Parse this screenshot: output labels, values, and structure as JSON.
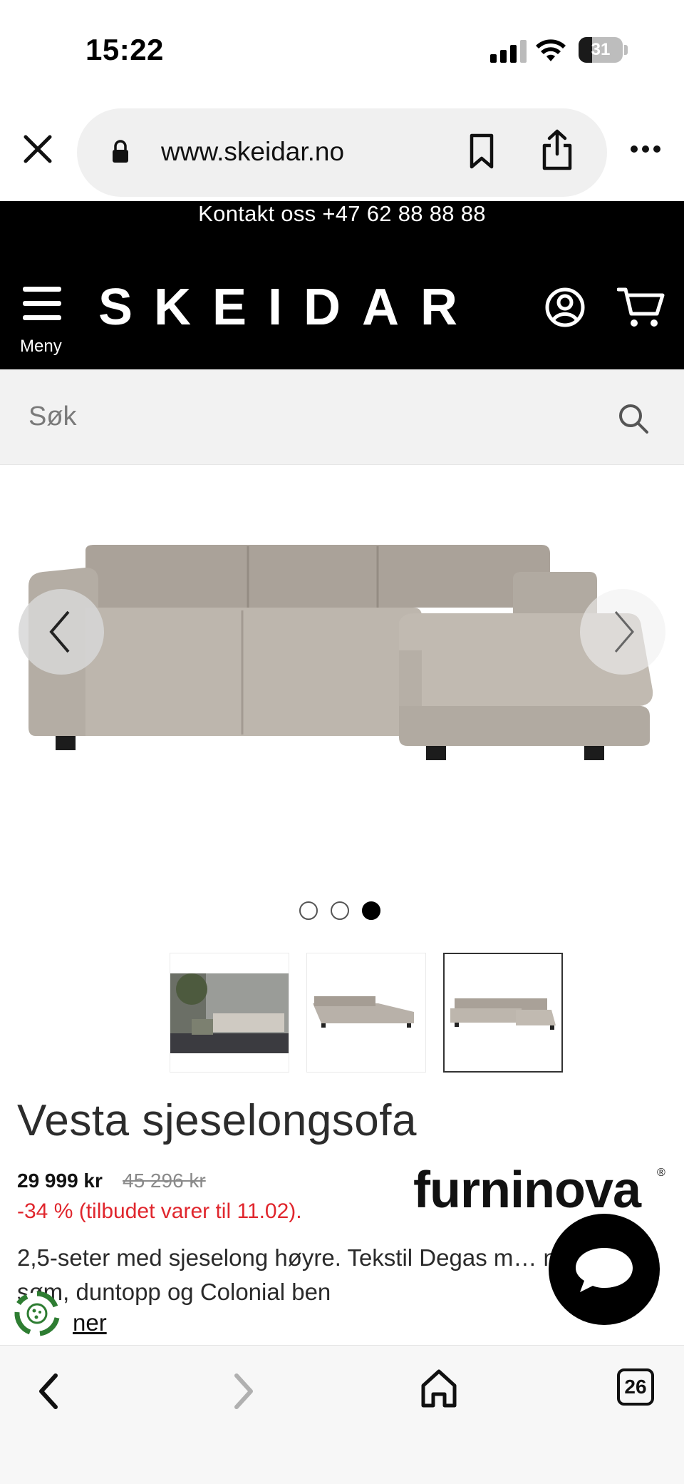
{
  "status_bar": {
    "time": "15:22",
    "battery_level": "31",
    "battery_fraction": 0.31
  },
  "browser": {
    "url": "www.skeidar.no",
    "tab_count": "26"
  },
  "header": {
    "contact": "Kontakt oss +47 62 88 88 88",
    "menu_label": "Meny",
    "logo": "SKEIDAR"
  },
  "search": {
    "placeholder": "Søk"
  },
  "gallery": {
    "slide_count": 3,
    "active_slide": 3,
    "colors": {
      "fabric": "#b8b1a9",
      "fabric_shadow": "#9f978e",
      "legs": "#1c1c1c"
    }
  },
  "product": {
    "title": "Vesta sjeselongsofa",
    "price": "29 999 kr",
    "old_price": "45 296 kr",
    "discount": "-34 % (tilbudet varer til 11.02).",
    "description": "2,5-seter med sjeselong høyre. Tekstil Degas m… ndard søm, duntopp og Colonial ben",
    "read_more": "ner",
    "brand": "furninova",
    "brand_mark": "®",
    "discount_color": "#e0262d"
  },
  "icons": {
    "close": "close-icon",
    "lock": "lock-icon",
    "bookmark": "bookmark-icon",
    "share": "share-icon",
    "more": "more-icon",
    "menu": "hamburger-icon",
    "account": "account-icon",
    "cart": "cart-icon",
    "search": "search-icon",
    "chat": "chat-icon",
    "back": "chevron-left-icon",
    "forward": "chevron-right-icon",
    "home": "home-icon"
  }
}
